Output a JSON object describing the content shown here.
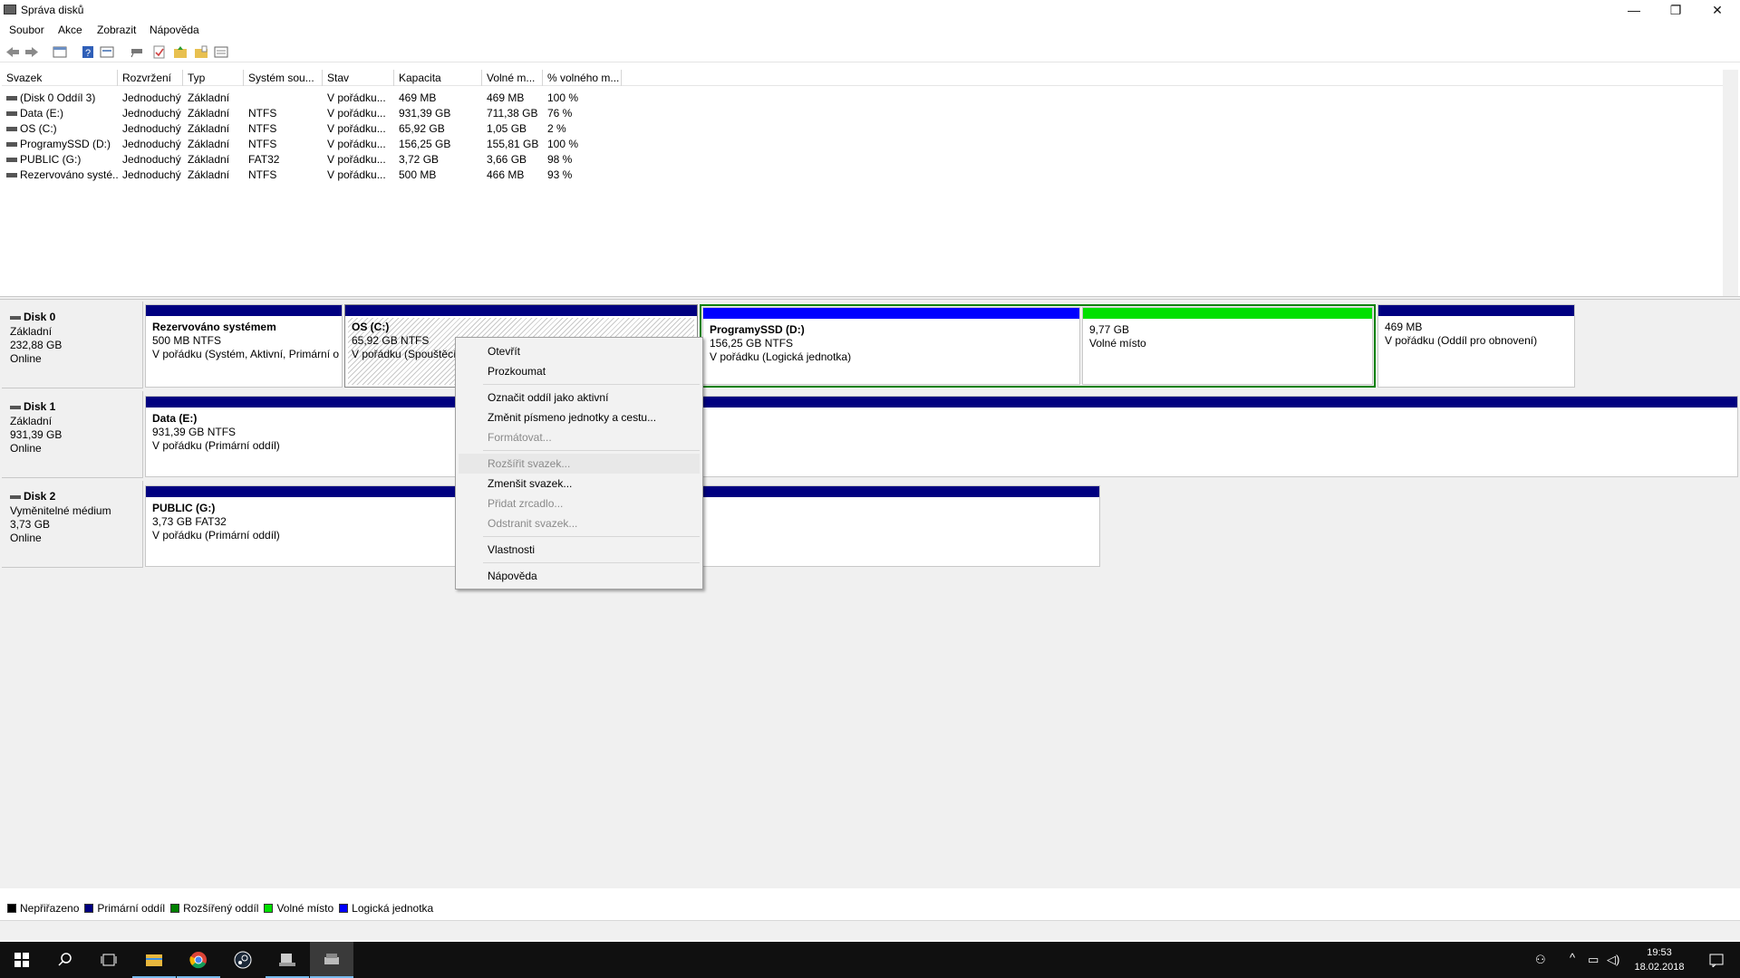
{
  "window": {
    "title": "Správa disků",
    "minimize": "—",
    "restore": "❐",
    "close": "✕"
  },
  "menu": [
    "Soubor",
    "Akce",
    "Zobrazit",
    "Nápověda"
  ],
  "toolbar_icons": [
    "back-icon",
    "forward-icon",
    "disk-list-icon",
    "help-icon",
    "properties-icon",
    "connect-icon",
    "check-icon",
    "folder-up-icon",
    "folder-open-icon",
    "view-icon"
  ],
  "volume_table": {
    "headers": [
      "Svazek",
      "Rozvržení",
      "Typ",
      "Systém sou...",
      "Stav",
      "Kapacita",
      "Volné m...",
      "% volného m..."
    ],
    "rows": [
      [
        "(Disk 0 Oddíl 3)",
        "Jednoduchý",
        "Základní",
        "",
        "V pořádku...",
        "469 MB",
        "469 MB",
        "100 %"
      ],
      [
        "Data (E:)",
        "Jednoduchý",
        "Základní",
        "NTFS",
        "V pořádku...",
        "931,39 GB",
        "711,38 GB",
        "76 %"
      ],
      [
        "OS (C:)",
        "Jednoduchý",
        "Základní",
        "NTFS",
        "V pořádku...",
        "65,92 GB",
        "1,05 GB",
        "2 %"
      ],
      [
        "ProgramySSD (D:)",
        "Jednoduchý",
        "Základní",
        "NTFS",
        "V pořádku...",
        "156,25 GB",
        "155,81 GB",
        "100 %"
      ],
      [
        "PUBLIC (G:)",
        "Jednoduchý",
        "Základní",
        "FAT32",
        "V pořádku...",
        "3,72 GB",
        "3,66 GB",
        "98 %"
      ],
      [
        "Rezervováno systé...",
        "Jednoduchý",
        "Základní",
        "NTFS",
        "V pořádku...",
        "500 MB",
        "466 MB",
        "93 %"
      ]
    ]
  },
  "disks": [
    {
      "name": "Disk 0",
      "type": "Základní",
      "size": "232,88 GB",
      "status": "Online",
      "partitions": [
        {
          "name": "Rezervováno systémem",
          "line1": "500 MB NTFS",
          "line2": "V pořádku (Systém, Aktivní, Primární o"
        },
        {
          "name": "OS  (C:)",
          "line1": "65,92 GB NTFS",
          "line2": "V pořádku (Spouštěcí"
        },
        {
          "name": "ProgramySSD  (D:)",
          "line1": "156,25 GB NTFS",
          "line2": "V pořádku (Logická jednotka)"
        },
        {
          "name": "",
          "line1": "9,77 GB",
          "line2": "Volné místo"
        },
        {
          "name": "",
          "line1": "469 MB",
          "line2": "V pořádku (Oddíl pro obnovení)"
        }
      ]
    },
    {
      "name": "Disk 1",
      "type": "Základní",
      "size": "931,39 GB",
      "status": "Online",
      "partitions": [
        {
          "name": "Data  (E:)",
          "line1": "931,39 GB NTFS",
          "line2": "V pořádku (Primární oddíl)"
        }
      ]
    },
    {
      "name": "Disk 2",
      "type": "Vyměnitelné médium",
      "size": "3,73 GB",
      "status": "Online",
      "partitions": [
        {
          "name": "PUBLIC  (G:)",
          "line1": "3,73 GB FAT32",
          "line2": "V pořádku (Primární oddíl)"
        }
      ]
    }
  ],
  "legend": [
    {
      "label": "Nepřiřazeno",
      "color": "#000000"
    },
    {
      "label": "Primární oddíl",
      "color": "#000080"
    },
    {
      "label": "Rozšířený oddíl",
      "color": "#008000"
    },
    {
      "label": "Volné místo",
      "color": "#00e000"
    },
    {
      "label": "Logická jednotka",
      "color": "#0000ff"
    }
  ],
  "context_menu": {
    "items": [
      {
        "label": "Otevřít",
        "enabled": true
      },
      {
        "label": "Prozkoumat",
        "enabled": true
      },
      {
        "label": "Označit oddíl jako aktivní",
        "enabled": true
      },
      {
        "label": "Změnit písmeno jednotky a cestu...",
        "enabled": true
      },
      {
        "label": "Formátovat...",
        "enabled": false
      },
      {
        "label": "Rozšířit svazek...",
        "enabled": false,
        "highlighted": true
      },
      {
        "label": "Zmenšit svazek...",
        "enabled": true
      },
      {
        "label": "Přidat zrcadlo...",
        "enabled": false
      },
      {
        "label": "Odstranit svazek...",
        "enabled": false
      },
      {
        "label": "Vlastnosti",
        "enabled": true
      },
      {
        "label": "Nápověda",
        "enabled": true
      }
    ]
  },
  "taskbar": {
    "apps": [
      "start-icon",
      "search-icon",
      "task-view-icon",
      "file-explorer-icon",
      "chrome-icon",
      "steam-icon",
      "app-icon",
      "disk-management-icon"
    ],
    "clock_time": "19:53",
    "clock_date": "18.02.2018"
  }
}
